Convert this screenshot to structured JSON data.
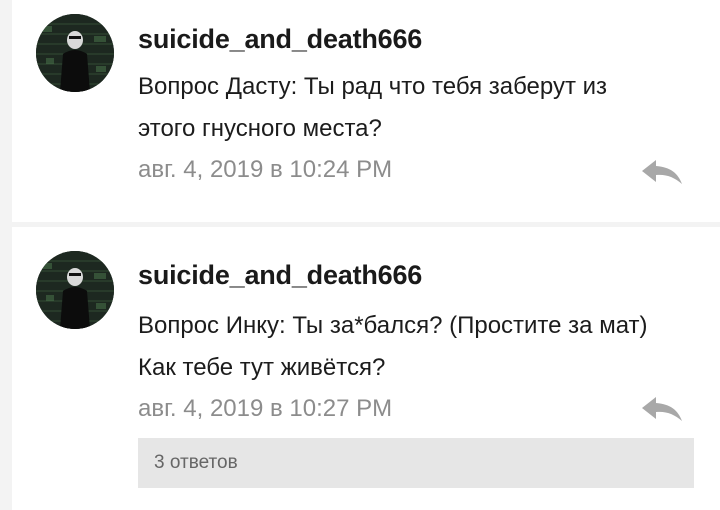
{
  "comments": [
    {
      "username": "suicide_and_death666",
      "line1": "Вопрос Дасту: Ты рад что тебя заберут из",
      "line2": "этого гнусного места?",
      "timestamp": "авг. 4, 2019 в 10:24 PM",
      "avatar_icon": "avatar-image",
      "reply_icon": "reply-arrow-icon"
    },
    {
      "username": "suicide_and_death666",
      "line1": "Вопрос Инку: Ты за*бался? (Простите за мат)",
      "line2": "Как тебе тут живётся?",
      "timestamp": "авг. 4, 2019 в 10:27 PM",
      "avatar_icon": "avatar-image",
      "reply_icon": "reply-arrow-icon",
      "replies_label": "3 ответов"
    }
  ],
  "colors": {
    "background": "#f3f3f3",
    "card": "#ffffff",
    "username": "#1a1a1a",
    "body": "#1c1c1c",
    "timestamp": "#8c8c8c",
    "reply_icon": "#a8a8a8",
    "replies_bg": "#e6e6e6",
    "replies_text": "#666666"
  }
}
